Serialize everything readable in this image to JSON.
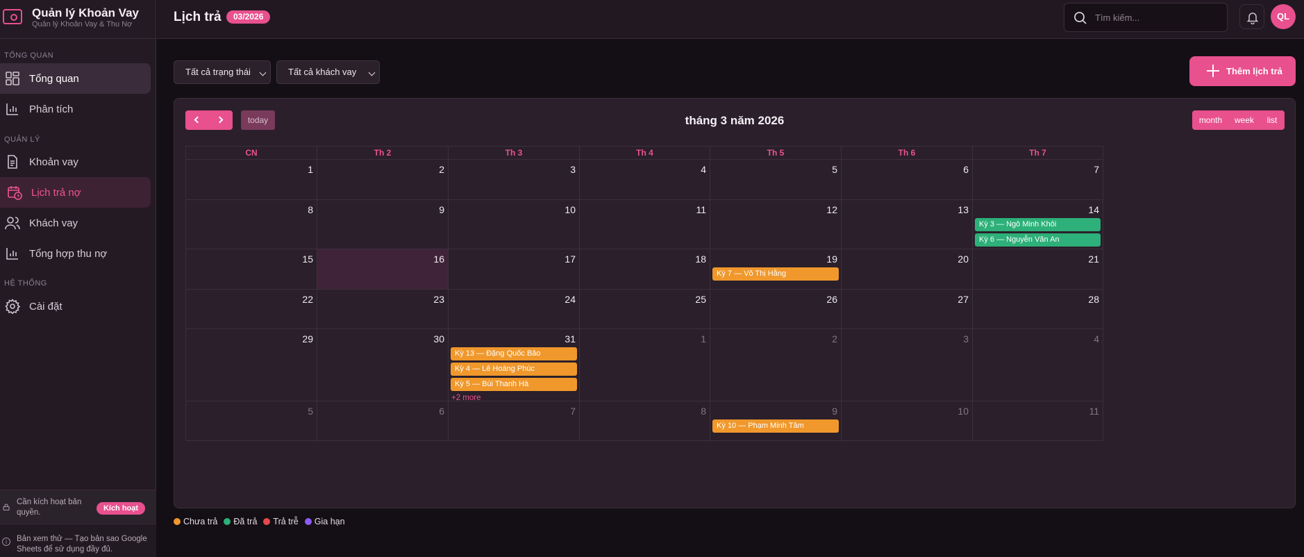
{
  "app": {
    "title": "Quản lý Khoản Vay",
    "subtitle": "Quản lý Khoản Vay & Thu Nợ"
  },
  "sidebar": {
    "sections": [
      {
        "label": "TỔNG QUAN"
      },
      {
        "label": "QUẢN LÝ"
      },
      {
        "label": "HỆ THỐNG"
      }
    ],
    "items": [
      {
        "label": "Tổng quan",
        "icon": "dashboard-icon"
      },
      {
        "label": "Phân tích",
        "icon": "bar-chart-icon"
      },
      {
        "label": "Khoản vay",
        "icon": "document-icon"
      },
      {
        "label": "Lịch trả nợ",
        "icon": "calendar-clock-icon",
        "active": true
      },
      {
        "label": "Khách vay",
        "icon": "users-icon"
      },
      {
        "label": "Tổng hợp thu nợ",
        "icon": "bar-chart-icon"
      },
      {
        "label": "Cài đặt",
        "icon": "gear-icon"
      }
    ],
    "activation": {
      "text": "Cần kích hoạt bản quyền.",
      "button": "Kích hoạt"
    },
    "trial": {
      "text": "Bản xem thử — Tạo bản sao Google Sheets để sử dụng đầy đủ."
    }
  },
  "header": {
    "title": "Lịch trả",
    "badge": "03/2026",
    "search_placeholder": "Tìm kiếm...",
    "avatar": "QL"
  },
  "filters": {
    "status": "Tất cả trạng thái",
    "borrower": "Tất cả khách vay",
    "add_button": "Thêm lịch trả"
  },
  "calendar": {
    "title": "tháng 3 năm 2026",
    "today_label": "today",
    "views": [
      "month",
      "week",
      "list"
    ],
    "weekdays": [
      "CN",
      "Th 2",
      "Th 3",
      "Th 4",
      "Th 5",
      "Th 6",
      "Th 7"
    ],
    "weeks": [
      {
        "days": [
          {
            "n": "1"
          },
          {
            "n": "2"
          },
          {
            "n": "3"
          },
          {
            "n": "4"
          },
          {
            "n": "5"
          },
          {
            "n": "6"
          },
          {
            "n": "7"
          }
        ]
      },
      {
        "days": [
          {
            "n": "8"
          },
          {
            "n": "9"
          },
          {
            "n": "10"
          },
          {
            "n": "11"
          },
          {
            "n": "12"
          },
          {
            "n": "13"
          },
          {
            "n": "14",
            "events": [
              {
                "text": "Kỳ 3 — Ngô Minh Khôi",
                "status": "paid"
              },
              {
                "text": "Kỳ 6 — Nguyễn Văn An",
                "status": "paid"
              }
            ]
          }
        ]
      },
      {
        "days": [
          {
            "n": "15"
          },
          {
            "n": "16",
            "today": true
          },
          {
            "n": "17"
          },
          {
            "n": "18"
          },
          {
            "n": "19",
            "events": [
              {
                "text": "Kỳ 7 — Võ Thị Hằng",
                "status": "unpaid"
              }
            ]
          },
          {
            "n": "20"
          },
          {
            "n": "21"
          }
        ]
      },
      {
        "days": [
          {
            "n": "22"
          },
          {
            "n": "23"
          },
          {
            "n": "24"
          },
          {
            "n": "25"
          },
          {
            "n": "26"
          },
          {
            "n": "27"
          },
          {
            "n": "28"
          }
        ]
      },
      {
        "days": [
          {
            "n": "29"
          },
          {
            "n": "30"
          },
          {
            "n": "31",
            "events": [
              {
                "text": "Kỳ 13 — Đặng Quốc Bảo",
                "status": "unpaid"
              },
              {
                "text": "Kỳ 4 — Lê Hoàng Phúc",
                "status": "unpaid"
              },
              {
                "text": "Kỳ 5 — Bùi Thanh Hà",
                "status": "unpaid"
              }
            ],
            "more": "+2 more"
          },
          {
            "n": "1",
            "other": true
          },
          {
            "n": "2",
            "other": true
          },
          {
            "n": "3",
            "other": true
          },
          {
            "n": "4",
            "other": true
          }
        ]
      },
      {
        "days": [
          {
            "n": "5",
            "other": true
          },
          {
            "n": "6",
            "other": true
          },
          {
            "n": "7",
            "other": true
          },
          {
            "n": "8",
            "other": true
          },
          {
            "n": "9",
            "other": true,
            "events": [
              {
                "text": "Kỳ 10 — Phạm Minh Tâm",
                "status": "unpaid"
              }
            ]
          },
          {
            "n": "10",
            "other": true
          },
          {
            "n": "11",
            "other": true
          }
        ]
      }
    ]
  },
  "legend": [
    {
      "label": "Chưa trả",
      "color": "#f0982c"
    },
    {
      "label": "Đã trả",
      "color": "#2db079"
    },
    {
      "label": "Trả trễ",
      "color": "#e5484d"
    },
    {
      "label": "Gia hạn",
      "color": "#8b5cf6"
    }
  ],
  "colors": {
    "accent": "#e8508e",
    "paid": "#2db079",
    "unpaid": "#f0982c"
  }
}
